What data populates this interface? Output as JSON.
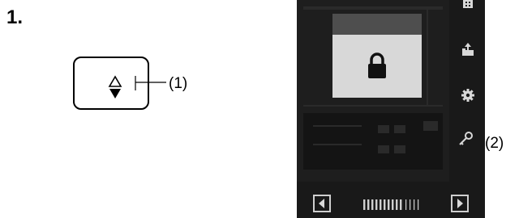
{
  "step": {
    "number": "1."
  },
  "callouts": {
    "button_key": "(1)",
    "key_icon": "(2)"
  },
  "icons": {
    "up_down": "up-down-triangle-icon",
    "lock": "lock-icon",
    "stack": "stack-icon",
    "upload": "upload-icon",
    "settings": "gear-icon",
    "key": "key-icon",
    "nav_left": "left-arrow-icon",
    "nav_right": "right-arrow-icon"
  },
  "colors": {
    "device_body": "#191919",
    "dialog_body": "#d8d8d8",
    "dialog_header": "#4e4e4e",
    "icon_light": "#d8d8d8"
  }
}
